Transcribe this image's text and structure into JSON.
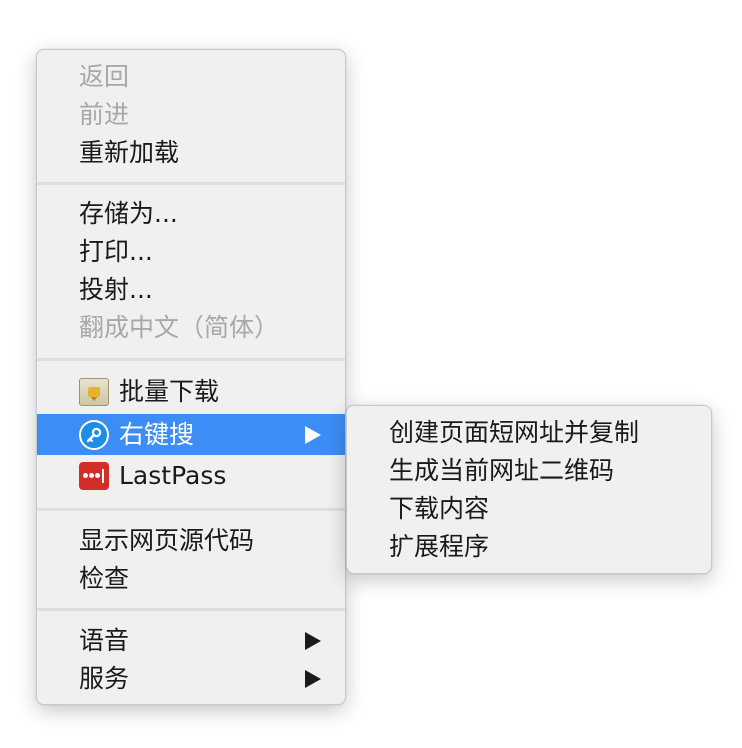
{
  "main_menu": {
    "back": "返回",
    "forward": "前进",
    "reload": "重新加载",
    "save_as": "存储为...",
    "print": "打印...",
    "cast": "投射...",
    "translate": "翻成中文（简体）",
    "batch_download": "批量下载",
    "right_search": "右键搜",
    "lastpass": "LastPass",
    "view_source": "显示网页源代码",
    "inspect": "检查",
    "speech": "语音",
    "services": "服务"
  },
  "submenu": {
    "items": [
      "创建页面短网址并复制",
      "生成当前网址二维码",
      "下载内容",
      "扩展程序"
    ]
  },
  "colors": {
    "highlight": "#3c8df5",
    "disabled_text": "#a8a8a8",
    "menu_background": "#f0f0f0"
  }
}
